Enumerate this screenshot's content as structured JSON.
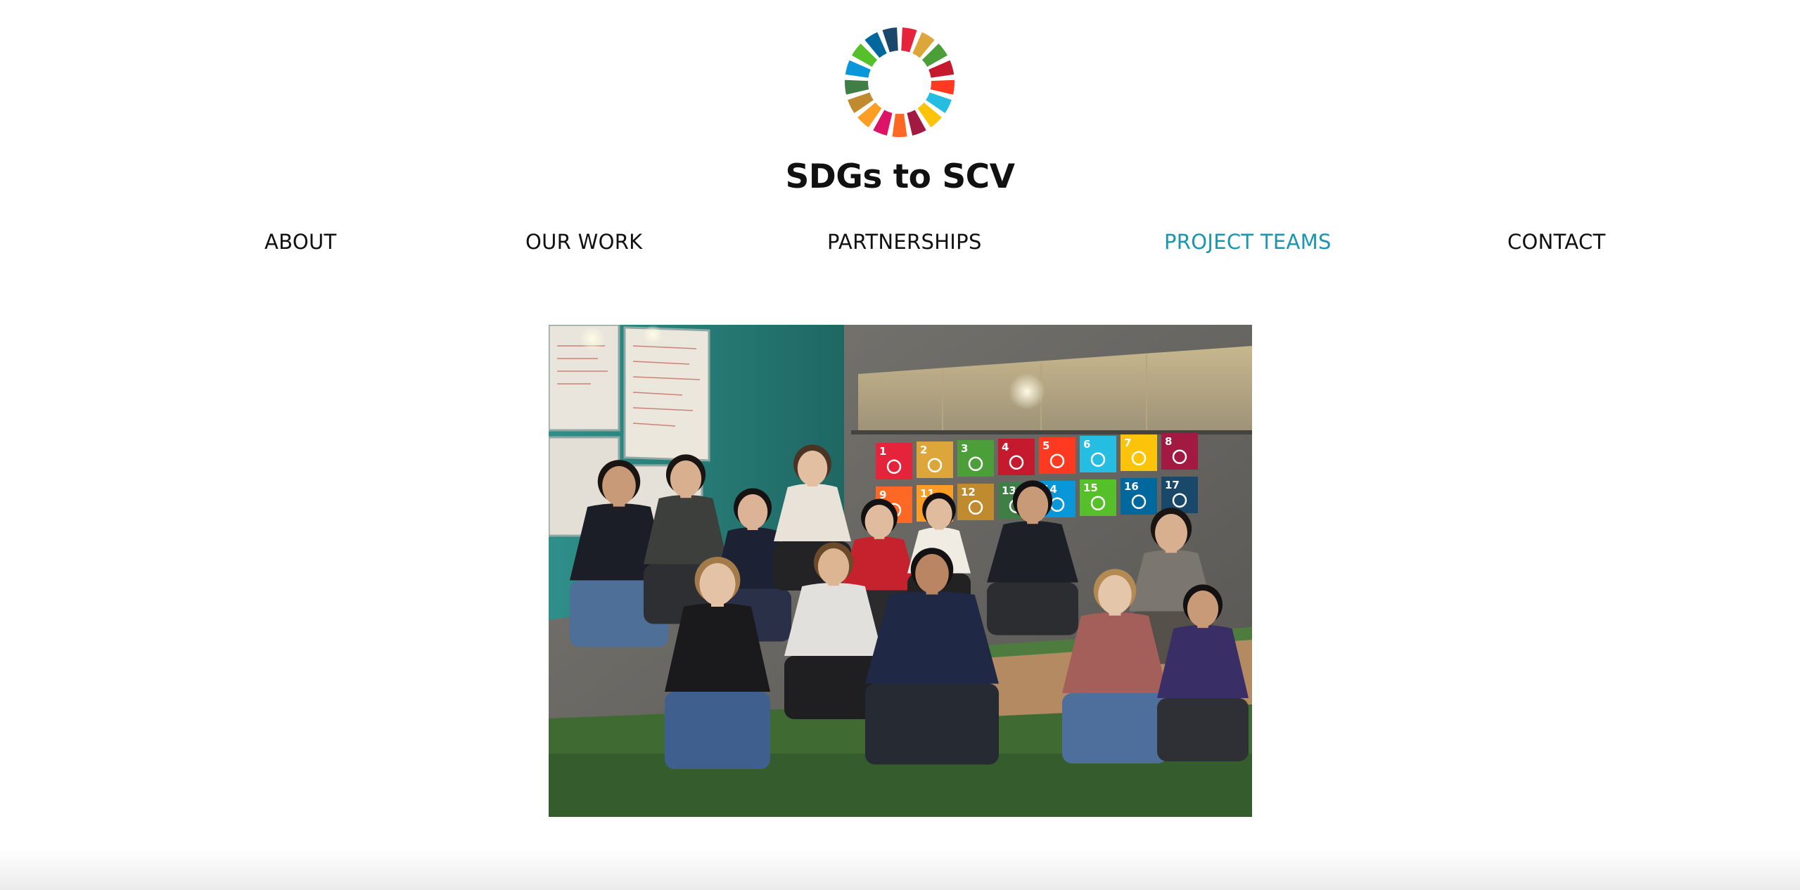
{
  "site": {
    "title": "SDGs to SCV",
    "logo_icon": "sdg-color-wheel-icon"
  },
  "nav": {
    "items": [
      {
        "label": "ABOUT",
        "active": false
      },
      {
        "label": "OUR WORK",
        "active": false
      },
      {
        "label": "PARTNERSHIPS",
        "active": false
      },
      {
        "label": "PROJECT TEAMS",
        "active": true
      },
      {
        "label": "CONTACT",
        "active": false
      }
    ],
    "active_color": "#1a97ae"
  },
  "hero": {
    "image_icon": "group-photo-image",
    "sdg_tiles": [
      {
        "num": "1",
        "color": "#e5243b"
      },
      {
        "num": "2",
        "color": "#dda63a"
      },
      {
        "num": "3",
        "color": "#4c9f38"
      },
      {
        "num": "4",
        "color": "#c5192d"
      },
      {
        "num": "5",
        "color": "#ff3a21"
      },
      {
        "num": "6",
        "color": "#26bde2"
      },
      {
        "num": "7",
        "color": "#fcc30b"
      },
      {
        "num": "8",
        "color": "#a21942"
      },
      {
        "num": "9",
        "color": "#fd6925"
      },
      {
        "num": "11",
        "color": "#fd9d24"
      },
      {
        "num": "12",
        "color": "#bf8b2e"
      },
      {
        "num": "13",
        "color": "#3f7e44"
      },
      {
        "num": "14",
        "color": "#0a97d9"
      },
      {
        "num": "15",
        "color": "#56c02b"
      },
      {
        "num": "16",
        "color": "#00689d"
      },
      {
        "num": "17",
        "color": "#19486a"
      }
    ]
  },
  "colors": {
    "sdg_wheel": [
      "#e5243b",
      "#dda63a",
      "#4c9f38",
      "#c5192d",
      "#ff3a21",
      "#26bde2",
      "#fcc30b",
      "#a21942",
      "#fd6925",
      "#dd1367",
      "#fd9d24",
      "#bf8b2e",
      "#3f7e44",
      "#0a97d9",
      "#56c02b",
      "#00689d",
      "#19486a"
    ]
  }
}
